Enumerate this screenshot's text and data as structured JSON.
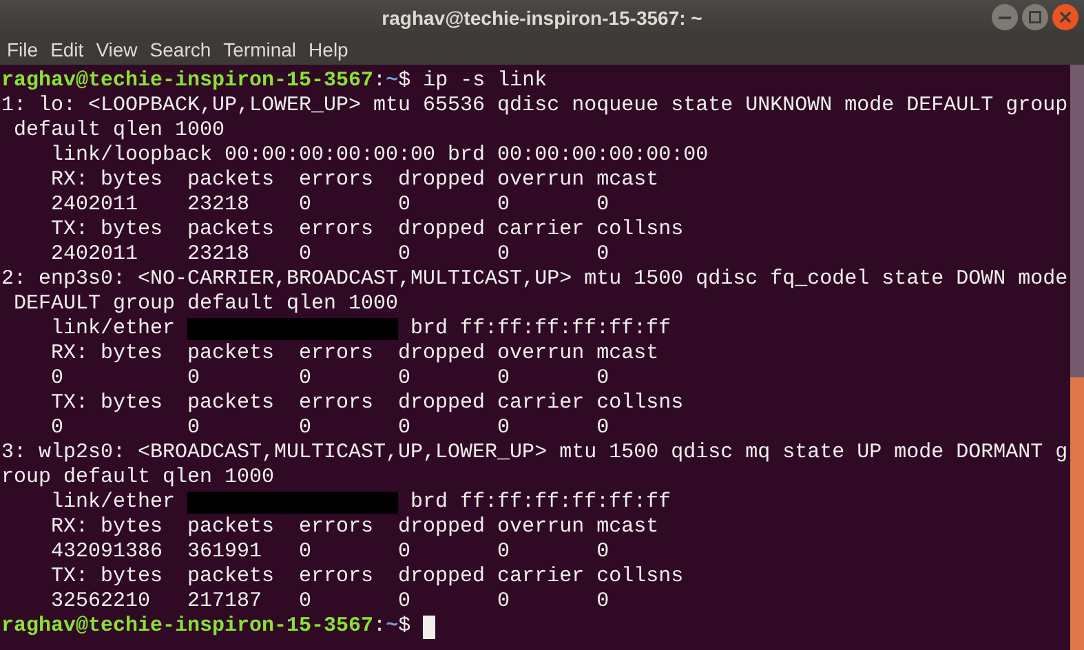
{
  "window": {
    "title": "raghav@techie-inspiron-15-3567: ~"
  },
  "menu": [
    "File",
    "Edit",
    "View",
    "Search",
    "Terminal",
    "Help"
  ],
  "lines": [
    {
      "kind": "prompt",
      "user": "raghav@techie-inspiron-15-3567",
      "sep": ":",
      "path": "~",
      "command": "$ ip -s link"
    },
    {
      "kind": "output",
      "text": "1: lo: <LOOPBACK,UP,LOWER_UP> mtu 65536 qdisc noqueue state UNKNOWN mode DEFAULT group"
    },
    {
      "kind": "output",
      "text": " default qlen 1000"
    },
    {
      "kind": "output",
      "text": "    link/loopback 00:00:00:00:00:00 brd 00:00:00:00:00:00"
    },
    {
      "kind": "output",
      "text": "    RX: bytes  packets  errors  dropped overrun mcast"
    },
    {
      "kind": "output",
      "text": "    2402011    23218    0       0       0       0"
    },
    {
      "kind": "output",
      "text": "    TX: bytes  packets  errors  dropped carrier collsns"
    },
    {
      "kind": "output",
      "text": "    2402011    23218    0       0       0       0"
    },
    {
      "kind": "output",
      "text": "2: enp3s0: <NO-CARRIER,BROADCAST,MULTICAST,UP> mtu 1500 qdisc fq_codel state DOWN mode"
    },
    {
      "kind": "output",
      "text": " DEFAULT group default qlen 1000"
    },
    {
      "kind": "redacted",
      "before": "    link/ether ",
      "after": " brd ff:ff:ff:ff:ff:ff"
    },
    {
      "kind": "output",
      "text": "    RX: bytes  packets  errors  dropped overrun mcast"
    },
    {
      "kind": "output",
      "text": "    0          0        0       0       0       0"
    },
    {
      "kind": "output",
      "text": "    TX: bytes  packets  errors  dropped carrier collsns"
    },
    {
      "kind": "output",
      "text": "    0          0        0       0       0       0"
    },
    {
      "kind": "output",
      "text": "3: wlp2s0: <BROADCAST,MULTICAST,UP,LOWER_UP> mtu 1500 qdisc mq state UP mode DORMANT g"
    },
    {
      "kind": "output",
      "text": "roup default qlen 1000"
    },
    {
      "kind": "redacted",
      "before": "    link/ether ",
      "after": " brd ff:ff:ff:ff:ff:ff"
    },
    {
      "kind": "output",
      "text": "    RX: bytes  packets  errors  dropped overrun mcast"
    },
    {
      "kind": "output",
      "text": "    432091386  361991   0       0       0       0"
    },
    {
      "kind": "output",
      "text": "    TX: bytes  packets  errors  dropped carrier collsns"
    },
    {
      "kind": "output",
      "text": "    32562210   217187   0       0       0       0"
    },
    {
      "kind": "prompt",
      "user": "raghav@techie-inspiron-15-3567",
      "sep": ":",
      "path": "~",
      "command": "$ ",
      "cursor": true
    }
  ]
}
